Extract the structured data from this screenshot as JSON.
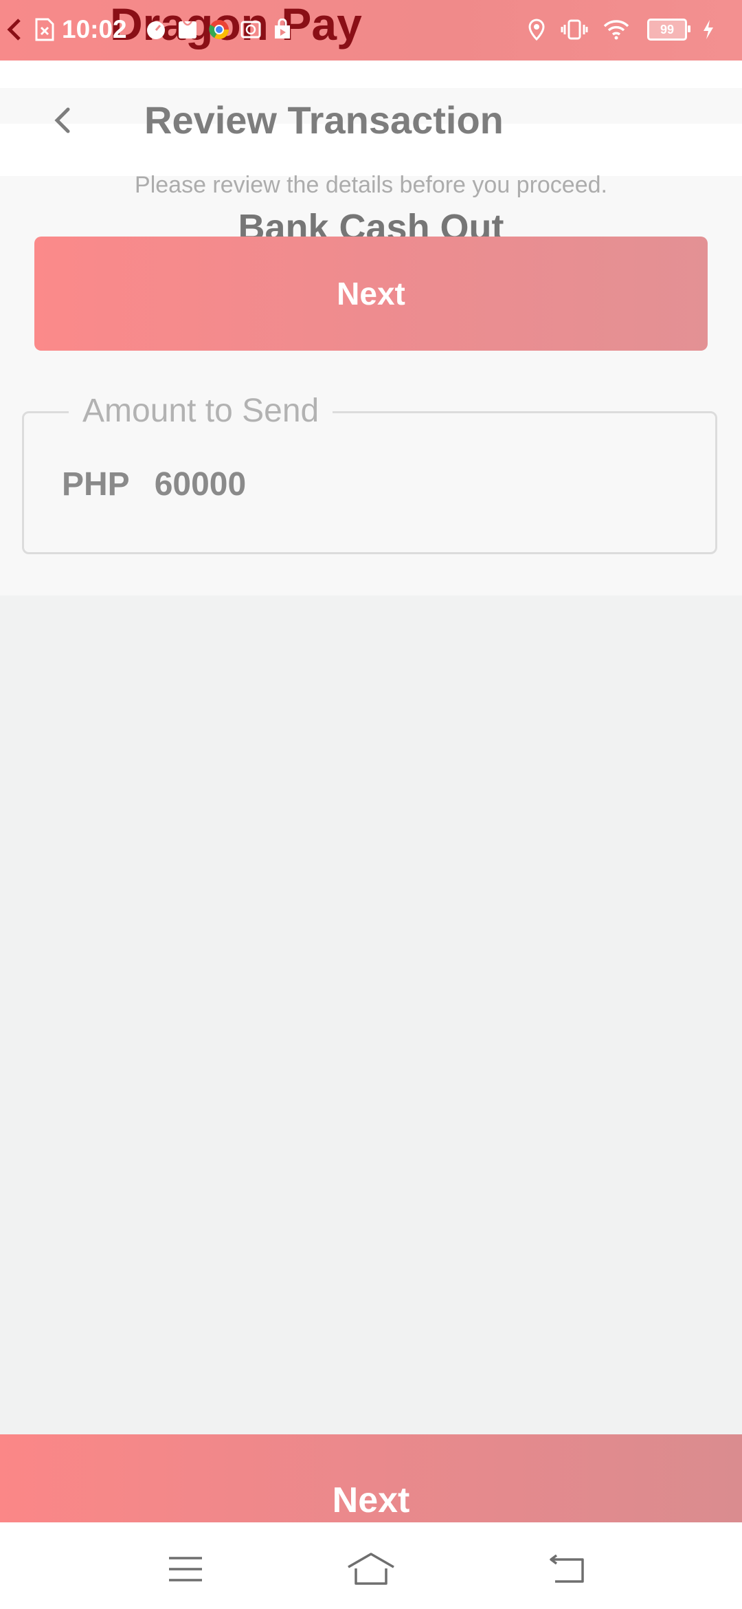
{
  "status_bar": {
    "time": "10:02",
    "battery_level": "99",
    "icons": [
      "back-arrow-icon",
      "file-icon",
      "timer-icon",
      "bag-icon",
      "chrome-icon",
      "mail-icon",
      "play-store-icon",
      "location-icon",
      "vibrate-icon",
      "wifi-icon",
      "battery-icon",
      "charging-icon"
    ]
  },
  "app": {
    "name": "Dragon Pay"
  },
  "header": {
    "title": "Review Transaction"
  },
  "main": {
    "subtitle": "Please review the details before you proceed.",
    "section_title": "Bank Cash Out",
    "next_label": "Next",
    "amount_field": {
      "label": "Amount to Send",
      "currency": "PHP",
      "value": "60000"
    }
  },
  "footer": {
    "next_label": "Next"
  },
  "nav_bar": {
    "icons": [
      "menu-icon",
      "home-icon",
      "back-icon"
    ]
  },
  "colors": {
    "accent": "#f78a8a",
    "brand_text": "#8a0f16",
    "background": "#f1f2f2"
  }
}
